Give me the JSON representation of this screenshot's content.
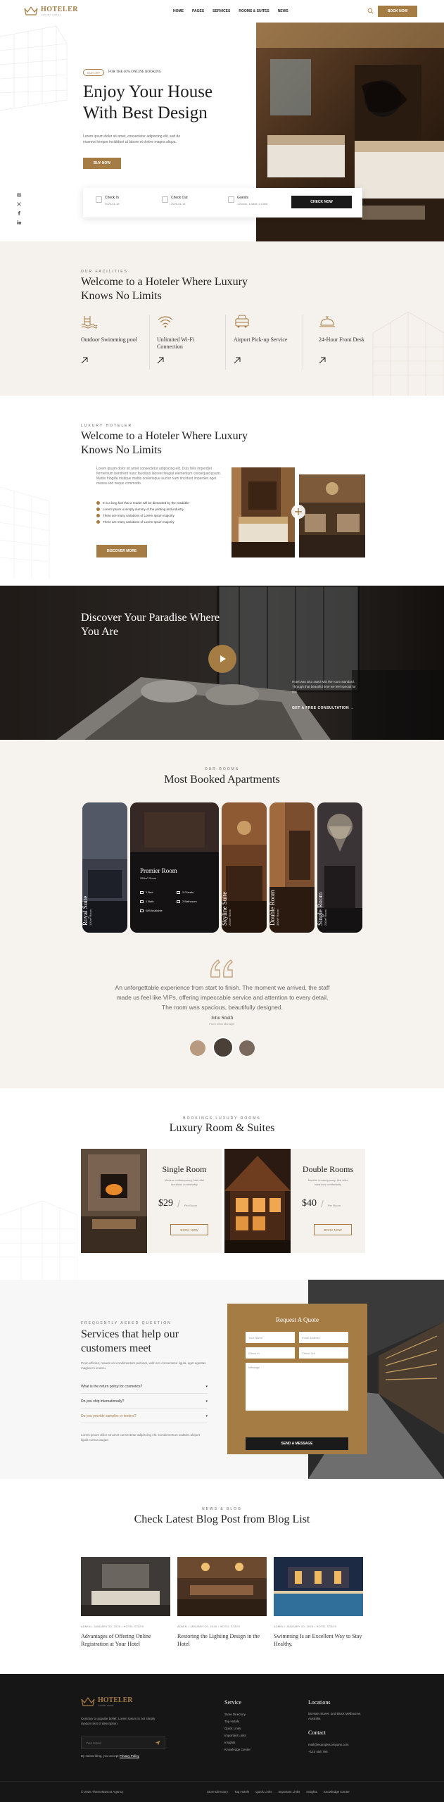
{
  "colors": {
    "accent": "#a67c45",
    "dark": "#161616",
    "cream": "#f5f1ec"
  },
  "nav": {
    "logo": "HOTELER",
    "logo_sub": "LUXURY HOTEL",
    "items": [
      "HOME",
      "PAGES",
      "SERVICES",
      "ROOMS & SUITES",
      "NEWS"
    ],
    "search_icon": "search-icon",
    "book_label": "BOOK NOW"
  },
  "hero": {
    "badge": "STAY OFF",
    "tag": "FOR THE 40% ONLINE BOOKING",
    "title_line1": "Enjoy Your House",
    "title_line2": "With Best Design",
    "desc": "Lorem ipsum dolor sit amet, consectetur adipiscing elit, sed do eiusmod tempor incididunt ut labore et dolore magna aliqua.",
    "buy_label": "BUY NOW",
    "booking": {
      "check_in_label": "Check In",
      "check_in_value": "2025-01-18",
      "check_out_label": "Check Out",
      "check_out_value": "2025-01-19",
      "guests_label": "Guests",
      "guests_value": "1 Room, 1 Adult, 0 Child",
      "check_label": "CHECK NOW"
    }
  },
  "facilities": {
    "eyebrow": "OUR FACILITIES",
    "title": "Welcome to a Hoteler Where Luxury Knows No Limits",
    "items": [
      {
        "name": "Outdoor Swimming pool",
        "icon": "pool-icon"
      },
      {
        "name": "Unlimited Wi-Fi Connection",
        "icon": "wifi-icon"
      },
      {
        "name": "Airport Pick-up Service",
        "icon": "car-icon"
      },
      {
        "name": "24-Hour Front Desk",
        "icon": "bell-icon"
      }
    ]
  },
  "about": {
    "eyebrow": "LUXURY HOTELER",
    "title": "Welcome to a Hoteler Where Luxury Knows No Limits",
    "desc": "Lorem ipsum dolor sit amet consectetur adipiscing elit. Duis felis imperdiet fermentum hendrerit nunc faucibus laoreet feugiat elementum consequat ipsum. Mattis fringilla tristique mattis scelerisque auctor nam tincidunt imperdiet eget massa sed neque commodo.",
    "bullets": [
      "It is a long fact that a reader will be distracted by the readable",
      "Lorem Ipsum is simply dummy of the printing and industry",
      "There are many variations of Lorem Ipsum majority",
      "There are many variations of Lorem Ipsum majority"
    ],
    "btn": "DISCOVER MORE"
  },
  "video": {
    "title": "Discover Your Paradise Where You Are",
    "desc": "Hotel was also rated with the room standard. Through that beautiful time we feel special for you.",
    "link": "GET A FREE CONSULTATION →"
  },
  "apartments": {
    "eyebrow": "OUR ROOMS",
    "title": "Most Booked Apartments",
    "cards": [
      {
        "name": "Royal Suite",
        "size": "120m² Room"
      },
      {
        "name": "Premier Room",
        "size": "350m² Room"
      },
      {
        "name": "Skyline Suite",
        "size": "220m² Room"
      },
      {
        "name": "Double Room",
        "size": "350m² Room"
      },
      {
        "name": "Single Room",
        "size": "200m² Room"
      }
    ],
    "amenities": [
      "1 Bed",
      "2 Guests",
      "1 Bath",
      "2 Bathroom",
      "Wifi Available"
    ],
    "testimonial": "An unforgettable experience from start to finish. The moment we arrived, the staff made us feel like VIPs, offering impeccable service and attention to every detail. The room was spacious, beautifully designed.",
    "name": "John Smith",
    "role": "Front Desk Manager"
  },
  "rooms": {
    "eyebrow": "BOOKINGS LUXURY ROOMS",
    "title": "Luxury Room & Suites",
    "items": [
      {
        "name": "Single Room",
        "desc": "Modern contemporary, fine offer luxurious comfortably",
        "price": "$29",
        "unit": "Per Room",
        "btn": "BOOK NOW"
      },
      {
        "name": "Double Rooms",
        "desc": "Modern contemporary, fine offer luxurious comfortably",
        "price": "$40",
        "unit": "Per Room",
        "btn": "BOOK NOW"
      }
    ]
  },
  "faq": {
    "eyebrow": "FREQUENTLY ASKED QUESTION",
    "title": "Services that help our customers meet",
    "desc": "Proin efficitur, mauris vel condimentum pulvinar, velit orci consectetur ligula, eget egestas magna mi ut arcu.",
    "questions": [
      "What is the return policy for cosmetics?",
      "Do you ship internationally?",
      "Do you provide samples or testers?"
    ],
    "foot": "Lorem ipsum dolor sit amet consectetur adipiscing elit. Condimentum sodales aliquet ligula cursus augue.",
    "quote": {
      "title": "Request A Quote",
      "name": "Your Name",
      "email": "Email Address",
      "check_in": "Check In",
      "check_out": "Check Out",
      "message": "Message",
      "send": "SEND A MESSAGE"
    }
  },
  "blog": {
    "eyebrow": "NEWS & BLOG",
    "title": "Check Latest Blog Post from Blog List",
    "posts": [
      {
        "meta": "ADMIN  •  JANUARY 20, 2025  •  HOTEL STAYS",
        "title": "Advantages of Offering Online Registration at Your Hotel"
      },
      {
        "meta": "ADMIN  •  JANUARY 20, 2025  •  HOTEL STAYS",
        "title": "Restoring the Lighting Design in the Hotel"
      },
      {
        "meta": "ADMIN  •  JANUARY 20, 2025  •  HOTEL STAYS",
        "title": "Swimming Is an Excellent Way to Stay Healthy."
      }
    ]
  },
  "footer": {
    "logo": "HOTELER",
    "logo_sub": "LUXURY HOTEL",
    "desc": "Contrary to popular belief, Lorem Ipsum is not simply random text of description.",
    "email_placeholder": "Your Email",
    "agree": "By subscribing, you accept",
    "agree_link": "Privacy Policy",
    "service_title": "Service",
    "services": [
      "Store Directory",
      "Top Hotels",
      "Quick Links",
      "Important Links",
      "Insights",
      "Knowledge Center"
    ],
    "locations_title": "Locations",
    "address": "56 Main Street, 2nd Block Melbourne, Australia",
    "contact_title": "Contact",
    "email": "mail@examplecompany.com",
    "phone": "+123 456 789",
    "copyright": "© 2025 ThemeMascot Agency",
    "bottom_links": [
      "Store Directory",
      "Top Hotels",
      "Quick Links",
      "Important Links",
      "Insights",
      "Knowledge Center"
    ]
  }
}
